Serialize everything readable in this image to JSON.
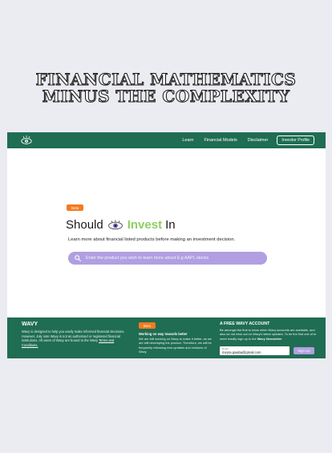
{
  "hero": {
    "line1": "FINANCIAL MATHEMATICS",
    "line2": "MINUS THE COMPLEXITY"
  },
  "nav": {
    "logo_icon": "eye-logo-icon",
    "links": [
      "Learn",
      "Financial Models",
      "Disclaimer"
    ],
    "cta": "Investor Profile"
  },
  "main": {
    "beta": "Beta",
    "headline_before": "Should",
    "headline_accent": "Invest",
    "headline_after": "In",
    "subline": "Learn more about financial listed products before making an investment decision.",
    "search_placeholder": "Enter the product you wish to learn more about E.g AAPL stocks"
  },
  "footer": {
    "brand": "WAVY",
    "desc": "Wavy is designed to help you easily make informed financial decisions. However, July note Wavy is not an authorised or registered financial institutions. All users of Wavy are bound to the Wavy",
    "terms": "Terms and Conditions.",
    "beta": "Beta",
    "mid_title": "Working on way towards better",
    "mid_body": "We are still working on Wavy to make it better, as we are still developing the product. Therefore, we will be frequently releasing new updates and versions of Wavy.",
    "right_title": "A FREE WAVY ACCOUNT",
    "right_body": "Be amongst the first to know when Wavy accounts are available, and also do not miss out on Wavy's latest updates. To be the first one of to meet readily sign up to the",
    "right_body_bold": "Wavy Newsletter",
    "email_label": "Email",
    "email_value": "meyra.gwaba@gmail.com",
    "signup": "Sign Up"
  },
  "colors": {
    "brand_green": "#1f6d52",
    "accent_orange": "#f47a20",
    "lavender": "#b19fe2",
    "invest_green": "#8fcf63"
  }
}
